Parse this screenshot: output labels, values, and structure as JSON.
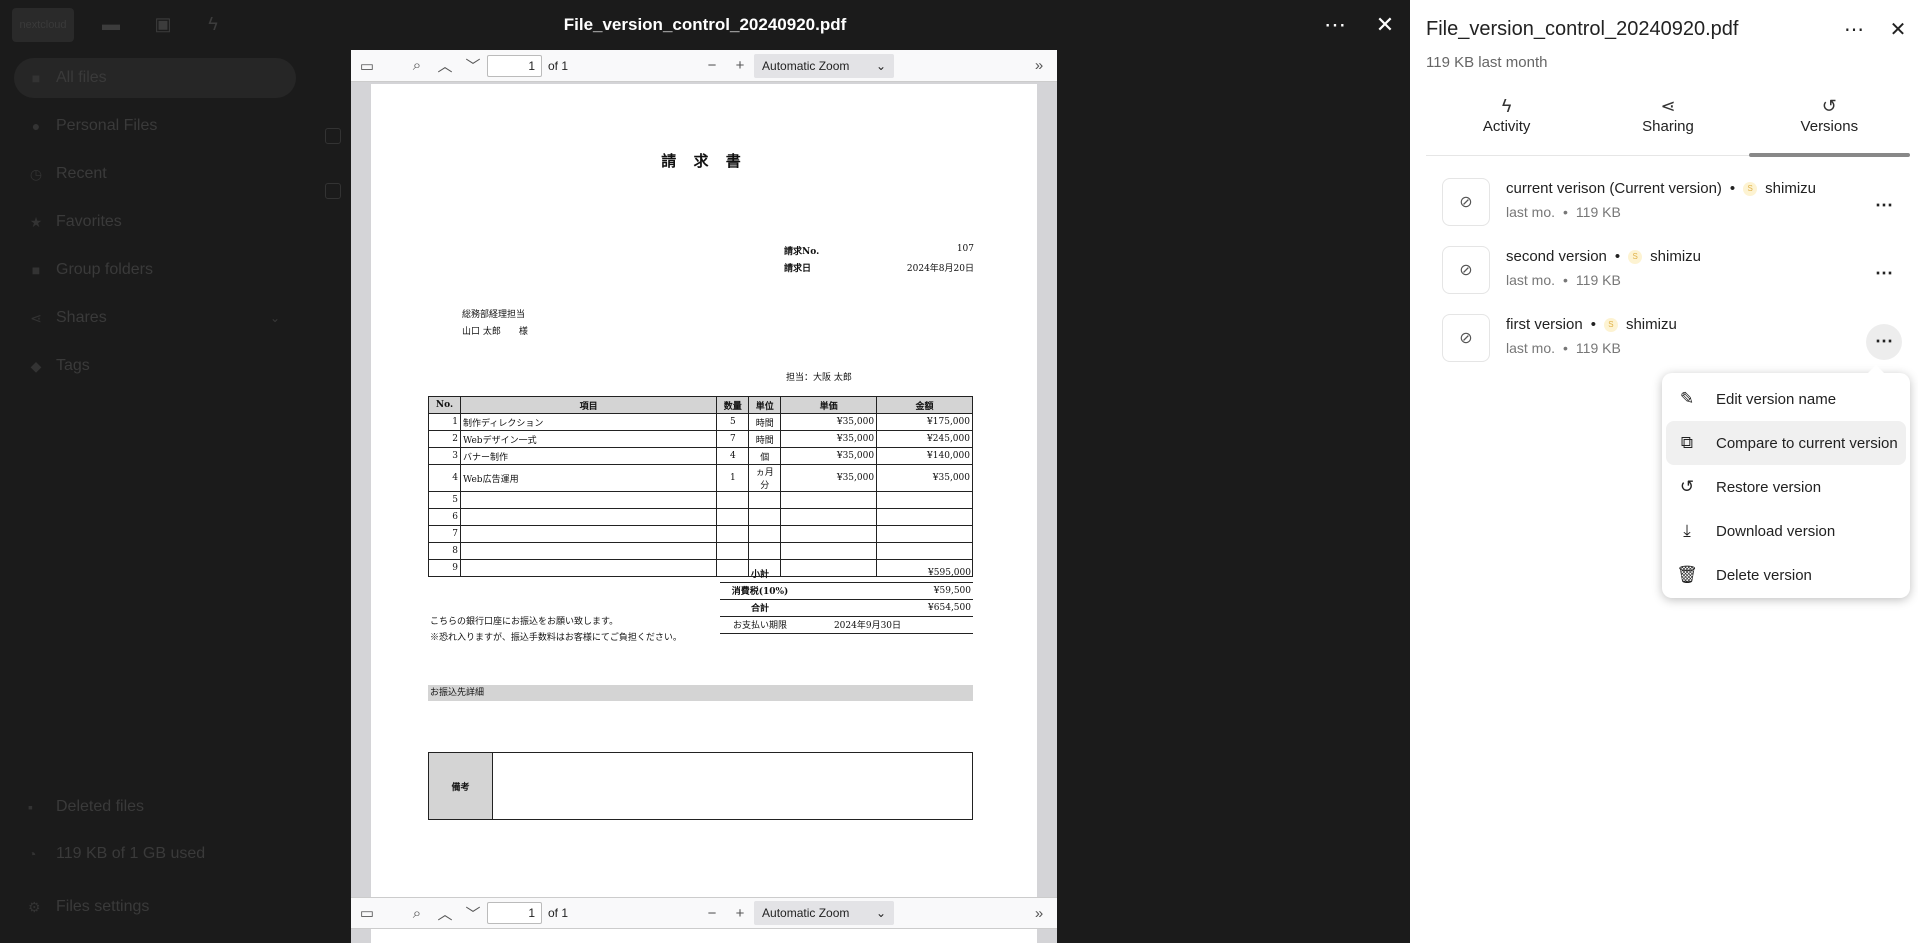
{
  "background_app": {
    "logo": "nextcloud",
    "nav": [
      {
        "label": "All files",
        "icon": "folder-icon",
        "active": true
      },
      {
        "label": "Personal Files",
        "icon": "user-icon"
      },
      {
        "label": "Recent",
        "icon": "clock-icon"
      },
      {
        "label": "Favorites",
        "icon": "star-icon"
      },
      {
        "label": "Group folders",
        "icon": "folder-group-icon"
      },
      {
        "label": "Shares",
        "icon": "share-icon"
      },
      {
        "label": "Tags",
        "icon": "tag-icon"
      }
    ],
    "deleted_files": "Deleted files",
    "quota": "119 KB of 1 GB used",
    "settings": "Files settings"
  },
  "viewer": {
    "title": "File_version_control_20240920.pdf",
    "toolbar": {
      "page_value": "1",
      "page_total": "of 1",
      "zoom": "Automatic Zoom"
    }
  },
  "invoice": {
    "title": "請 求 書",
    "no_label": "請求No.",
    "no_value": "107",
    "date_label": "請求日",
    "date_value": "2024年8月20日",
    "recipient_dept": "総務部経理担当",
    "recipient_name": "山口 太郎　　様",
    "contact": "担当：大阪 太郎",
    "headers": [
      "No.",
      "項目",
      "数量",
      "単位",
      "単価",
      "金額"
    ],
    "rows": [
      [
        "1",
        "制作ディレクション",
        "5",
        "時間",
        "¥35,000",
        "¥175,000"
      ],
      [
        "2",
        "Webデザイン一式",
        "7",
        "時間",
        "¥35,000",
        "¥245,000"
      ],
      [
        "3",
        "バナー制作",
        "4",
        "個",
        "¥35,000",
        "¥140,000"
      ],
      [
        "4",
        "Web広告運用",
        "1",
        "ヵ月分",
        "¥35,000",
        "¥35,000"
      ],
      [
        "5",
        "",
        "",
        "",
        "",
        ""
      ],
      [
        "6",
        "",
        "",
        "",
        "",
        ""
      ],
      [
        "7",
        "",
        "",
        "",
        "",
        ""
      ],
      [
        "8",
        "",
        "",
        "",
        "",
        ""
      ],
      [
        "9",
        "",
        "",
        "",
        "",
        ""
      ]
    ],
    "subtotal_label": "小計",
    "subtotal_value": "¥595,000",
    "tax_label": "消費税(10%)",
    "tax_value": "¥59,500",
    "total_label": "合計",
    "total_value": "¥654,500",
    "due_label": "お支払い期限",
    "due_value": "2024年9月30日",
    "note1": "こちらの銀行口座にお振込をお願い致します。",
    "note2": "※恐れ入りますが、振込手数料はお客様にてご負担ください。",
    "bank_label": "お振込先詳細",
    "remarks_label": "備考"
  },
  "sidebar": {
    "title": "File_version_control_20240920.pdf",
    "subtitle": "119 KB last month",
    "tabs": [
      {
        "label": "Activity",
        "icon": "lightning-icon"
      },
      {
        "label": "Sharing",
        "icon": "share-icon"
      },
      {
        "label": "Versions",
        "icon": "history-icon",
        "active": true
      }
    ],
    "versions": [
      {
        "name": "current verison (Current version)",
        "user": "shimizu",
        "avatar": "S",
        "time": "last mo.",
        "size": "119 KB"
      },
      {
        "name": "second version",
        "user": "shimizu",
        "avatar": "S",
        "time": "last mo.",
        "size": "119 KB"
      },
      {
        "name": "first version",
        "user": "shimizu",
        "avatar": "S",
        "time": "last mo.",
        "size": "119 KB"
      }
    ],
    "separator": "•"
  },
  "menu": {
    "items": [
      {
        "label": "Edit version name",
        "icon": "pencil-icon"
      },
      {
        "label": "Compare to current version",
        "icon": "compare-icon"
      },
      {
        "label": "Restore version",
        "icon": "restore-icon"
      },
      {
        "label": "Download version",
        "icon": "download-icon"
      },
      {
        "label": "Delete version",
        "icon": "trash-icon"
      }
    ]
  }
}
